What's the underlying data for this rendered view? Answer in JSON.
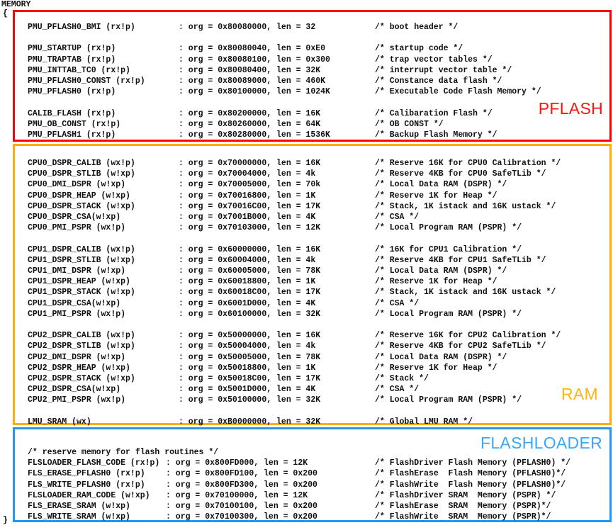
{
  "script": {
    "keyword": "MEMORY",
    "brace_open": "{",
    "brace_close": "}"
  },
  "regions": [
    {
      "id": "pflash",
      "label": "PFLASH",
      "color": "#ff0000",
      "label_color": "#ff1111",
      "lines": [
        {
          "sym": "PMU_PFLASH0_BMI (rx!p)",
          "org": ": org = 0x80080000, len = 32",
          "cmt": "/* boot header */"
        },
        {
          "sym": "",
          "org": "",
          "cmt": ""
        },
        {
          "sym": "PMU_STARTUP (rx!p)",
          "org": ": org = 0x80080040, len = 0xE0",
          "cmt": "/* startup code */"
        },
        {
          "sym": "PMU_TRAPTAB (rx!p)",
          "org": ": org = 0x80080100, len = 0x300",
          "cmt": "/* trap vector tables */"
        },
        {
          "sym": "PMU_INTTAB_TC0 (rx!p)",
          "org": ": org = 0x80080400, len = 32K",
          "cmt": "/* interrupt vector table */"
        },
        {
          "sym": "PMU_PFLASH0_CONST (rx!p)",
          "org": ": org = 0x80089000, len = 460K",
          "cmt": "/* Constance data flash */"
        },
        {
          "sym": "PMU_PFLASH0 (rx!p)",
          "org": ": org = 0x80100000, len = 1024K",
          "cmt": "/* Executable Code Flash Memory */"
        },
        {
          "sym": "",
          "org": "",
          "cmt": ""
        },
        {
          "sym": "CALIB_FLASH (rx!p)",
          "org": ": org = 0x80200000, len = 16K",
          "cmt": "/* Calibaration Flash */"
        },
        {
          "sym": "PMU_OB_CONST (rx!p)",
          "org": ": org = 0x80260000, len = 64K",
          "cmt": "/* OB CONST */"
        },
        {
          "sym": "PMU_PFLASH1 (rx!p)",
          "org": ": org = 0x80280000, len = 1536K",
          "cmt": "/* Backup Flash Memory */"
        }
      ]
    },
    {
      "id": "ram",
      "label": "RAM",
      "color": "#ffae00",
      "label_color": "#ffb511",
      "lines": [
        {
          "sym": "CPU0_DSPR_CALIB (wx!p)",
          "org": ": org = 0x70000000, len = 16K",
          "cmt": "/* Reserve 16K for CPU0 Calibration */"
        },
        {
          "sym": "CPU0_DSPR_STLIB (w!xp)",
          "org": ": org = 0x70004000, len = 4k",
          "cmt": "/* Reserve 4KB for CPU0 SafeTLib */"
        },
        {
          "sym": "CPU0_DMI_DSPR (w!xp)",
          "org": ": org = 0x70005000, len = 70k",
          "cmt": "/* Local Data RAM (DSPR) */"
        },
        {
          "sym": "CPU0_DSPR_HEAP (w!xp)",
          "org": ": org = 0x70016800, len = 1K",
          "cmt": "/* Reserve 1K for Heap */"
        },
        {
          "sym": "CPU0_DSPR_STACK (w!xp)",
          "org": ": org = 0x70016C00, len = 17K",
          "cmt": "/* Stack, 1K istack and 16K ustack */"
        },
        {
          "sym": "CPU0_DSPR_CSA(w!xp)",
          "org": ": org = 0x7001B000, len = 4K",
          "cmt": "/* CSA */"
        },
        {
          "sym": "CPU0_PMI_PSPR (wx!p)",
          "org": ": org = 0x70103000, len = 12K",
          "cmt": "/* Local Program RAM (PSPR) */"
        },
        {
          "sym": "",
          "org": "",
          "cmt": ""
        },
        {
          "sym": "CPU1_DSPR_CALIB (wx!p)",
          "org": ": org = 0x60000000, len = 16K",
          "cmt": "/* 16K for CPU1 Calibration */"
        },
        {
          "sym": "CPU1_DSPR_STLIB (w!xp)",
          "org": ": org = 0x60004000, len = 4k",
          "cmt": "/* Reserve 4KB for CPU1 SafeTLib */"
        },
        {
          "sym": "CPU1_DMI_DSPR (w!xp)",
          "org": ": org = 0x60005000, len = 78K",
          "cmt": "/* Local Data RAM (DSPR) */"
        },
        {
          "sym": "CPU1_DSPR_HEAP (w!xp)",
          "org": ": org = 0x60018800, len = 1K",
          "cmt": "/* Reserve 1K for Heap */"
        },
        {
          "sym": "CPU1_DSPR_STACK (w!xp)",
          "org": ": org = 0x60018C00, len = 17K",
          "cmt": "/* Stack, 1K istack and 16K ustack */"
        },
        {
          "sym": "CPU1_DSPR_CSA(w!xp)",
          "org": ": org = 0x6001D000, len = 4K",
          "cmt": "/* CSA */"
        },
        {
          "sym": "CPU1_PMI_PSPR (wx!p)",
          "org": ": org = 0x60100000, len = 32K",
          "cmt": "/* Local Program RAM (PSPR) */"
        },
        {
          "sym": "",
          "org": "",
          "cmt": ""
        },
        {
          "sym": "CPU2_DSPR_CALIB (wx!p)",
          "org": ": org = 0x50000000, len = 16K",
          "cmt": "/* Reserve 16K for CPU2 Calibration */"
        },
        {
          "sym": "CPU2_DSPR_STLIB (w!xp)",
          "org": ": org = 0x50004000, len = 4k",
          "cmt": "/* Reserve 4KB for CPU2 SafeTLib */"
        },
        {
          "sym": "CPU2_DMI_DSPR (w!xp)",
          "org": ": org = 0x50005000, len = 78K",
          "cmt": "/* Local Data RAM (DSPR) */"
        },
        {
          "sym": "CPU2_DSPR_HEAP (w!xp)",
          "org": ": org = 0x50018800, len = 1K",
          "cmt": "/* Reserve 1K for Heap */"
        },
        {
          "sym": "CPU2_DSPR_STACK (w!xp)",
          "org": ": org = 0x50018C00, len = 17K",
          "cmt": "/* Stack */"
        },
        {
          "sym": "CPU2_DSPR_CSA(w!xp)",
          "org": ": org = 0x5001D000, len = 4K",
          "cmt": "/* CSA */"
        },
        {
          "sym": "CPU2_PMI_PSPR (wx!p)",
          "org": ": org = 0x50100000, len = 32K",
          "cmt": "/* Local Program RAM (PSPR) */"
        },
        {
          "sym": "",
          "org": "",
          "cmt": ""
        },
        {
          "sym": "LMU_SRAM (wx)",
          "org": ": org = 0xB0000000, len = 32K",
          "cmt": "/* Global LMU RAM */"
        }
      ]
    },
    {
      "id": "flashloader",
      "label": "FLASHLOADER",
      "color": "#2196f3",
      "label_color": "#3ba7f7",
      "lines": [
        {
          "sym": "/* reserve memory for flash routines */",
          "org": "",
          "cmt": ""
        },
        {
          "sym": "FLSLOADER_FLASH_CODE (rx!p)",
          "org": ": org = 0x800FD000, len = 12K",
          "cmt": "/* FlashDriver Flash Memory (PFLASH0) */"
        },
        {
          "sym": "FLS_ERASE_PFLASH0 (rx!p)",
          "org": ": org = 0x800FD100, len = 0x200",
          "cmt": "/* FlashErase  Flash Memory (PFLASH0)*/"
        },
        {
          "sym": "FLS_WRITE_PFLASH0 (rx!p)",
          "org": ": org = 0x800FD300, len = 0x200",
          "cmt": "/* FlashWrite  Flash Memory (PFLASH0)*/"
        },
        {
          "sym": "FLSLOADER_RAM_CODE (w!xp)",
          "org": ": org = 0x70100000, len = 12K",
          "cmt": "/* FlashDriver SRAM  Memory (PSPR) */"
        },
        {
          "sym": "FLS_ERASE_SRAM (w!xp)",
          "org": ": org = 0x70100100, len = 0x200",
          "cmt": "/* FlashErase  SRAM  Memory (PSPR)*/"
        },
        {
          "sym": "FLS_WRITE_SRAM (w!xp)",
          "org": ": org = 0x70100300, len = 0x200",
          "cmt": "/* FlashWrite  SRAM  Memory (PSPR)*/"
        }
      ]
    }
  ]
}
